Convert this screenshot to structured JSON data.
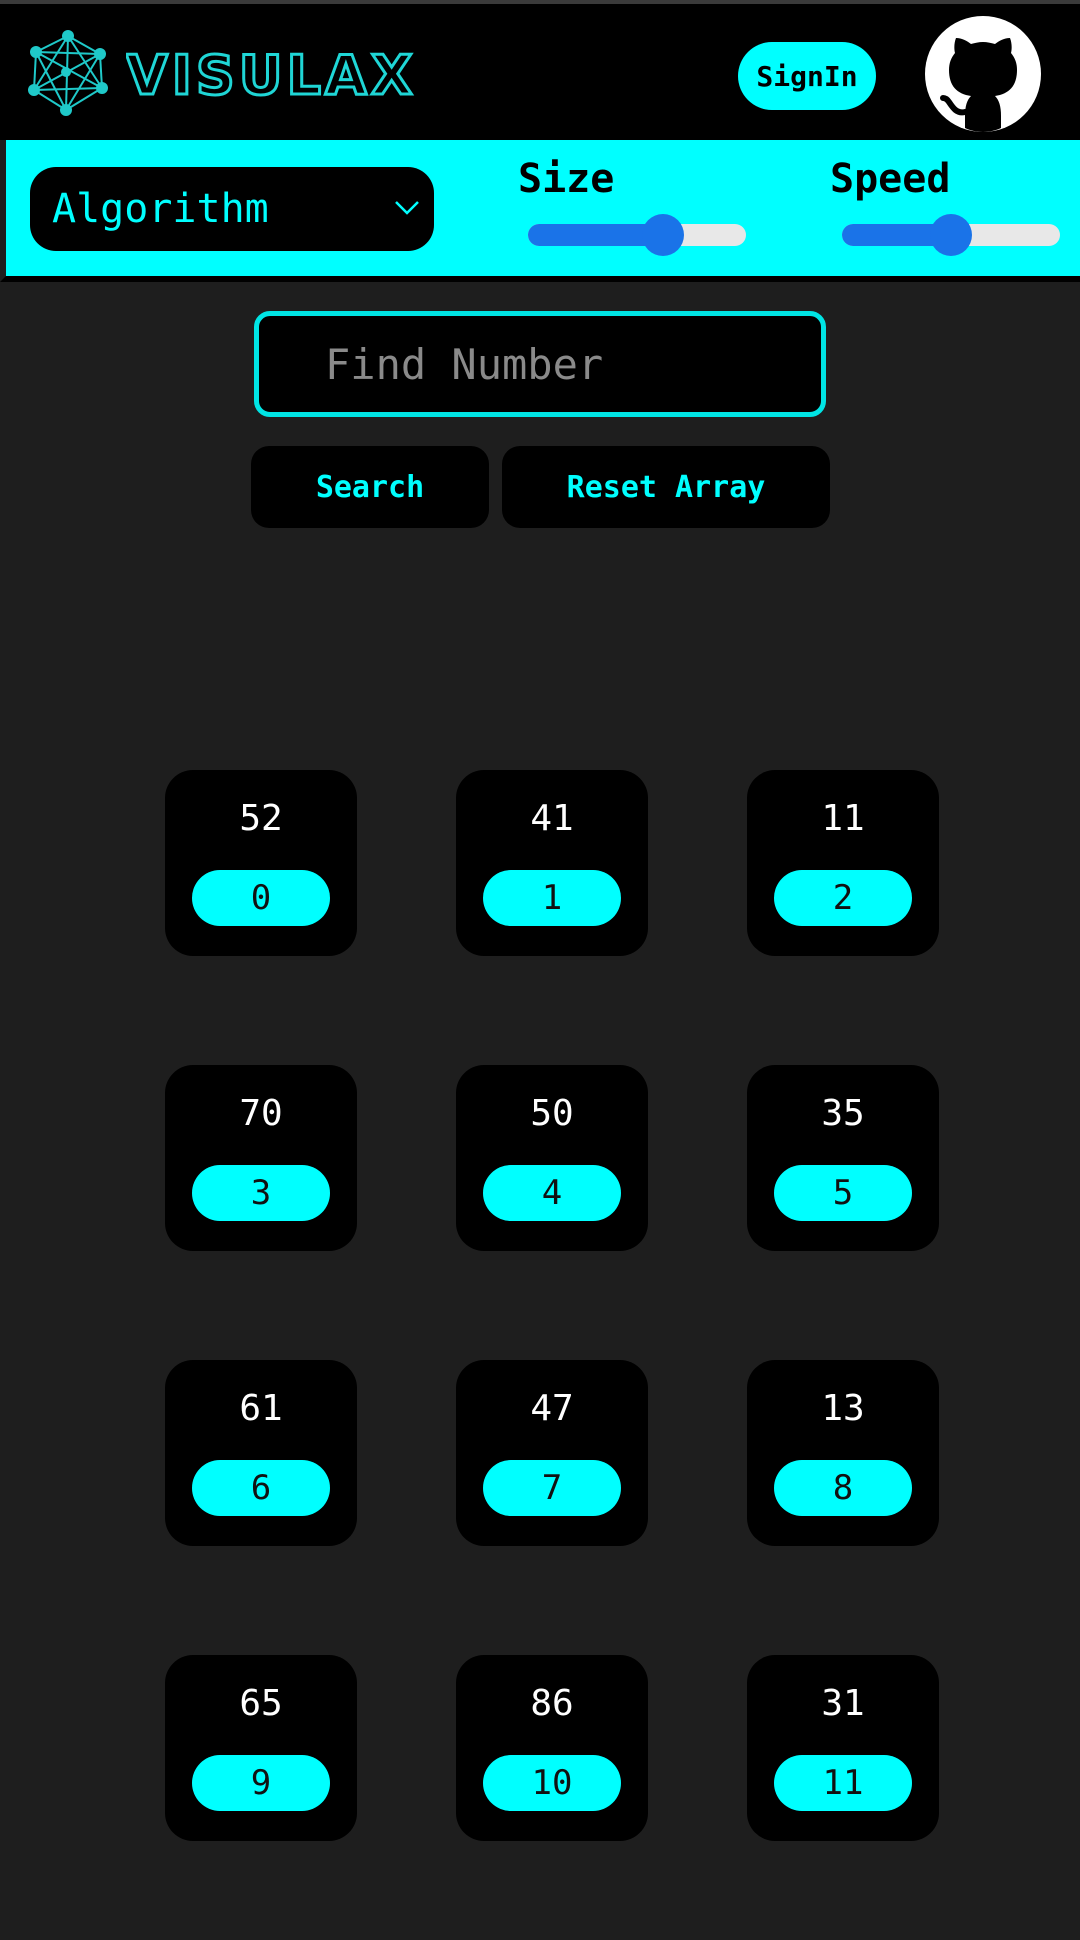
{
  "header": {
    "brand": "VISULAX",
    "signin_label": "SignIn",
    "icons": {
      "logo": "network-graph-icon",
      "github": "github-icon"
    }
  },
  "controls": {
    "algorithm_label": "Algorithm",
    "size_label": "Size",
    "speed_label": "Speed",
    "size_level": 0.62,
    "speed_level": 0.5
  },
  "search": {
    "placeholder": "Find Number",
    "search_label": "Search",
    "reset_label": "Reset Array"
  },
  "array": [
    {
      "value": "52",
      "index": "0"
    },
    {
      "value": "41",
      "index": "1"
    },
    {
      "value": "11",
      "index": "2"
    },
    {
      "value": "70",
      "index": "3"
    },
    {
      "value": "50",
      "index": "4"
    },
    {
      "value": "35",
      "index": "5"
    },
    {
      "value": "61",
      "index": "6"
    },
    {
      "value": "47",
      "index": "7"
    },
    {
      "value": "13",
      "index": "8"
    },
    {
      "value": "65",
      "index": "9"
    },
    {
      "value": "86",
      "index": "10"
    },
    {
      "value": "31",
      "index": "11"
    }
  ],
  "colors": {
    "accent": "#00ffff",
    "background": "#1e1e1e",
    "slider": "#1a73e8"
  }
}
